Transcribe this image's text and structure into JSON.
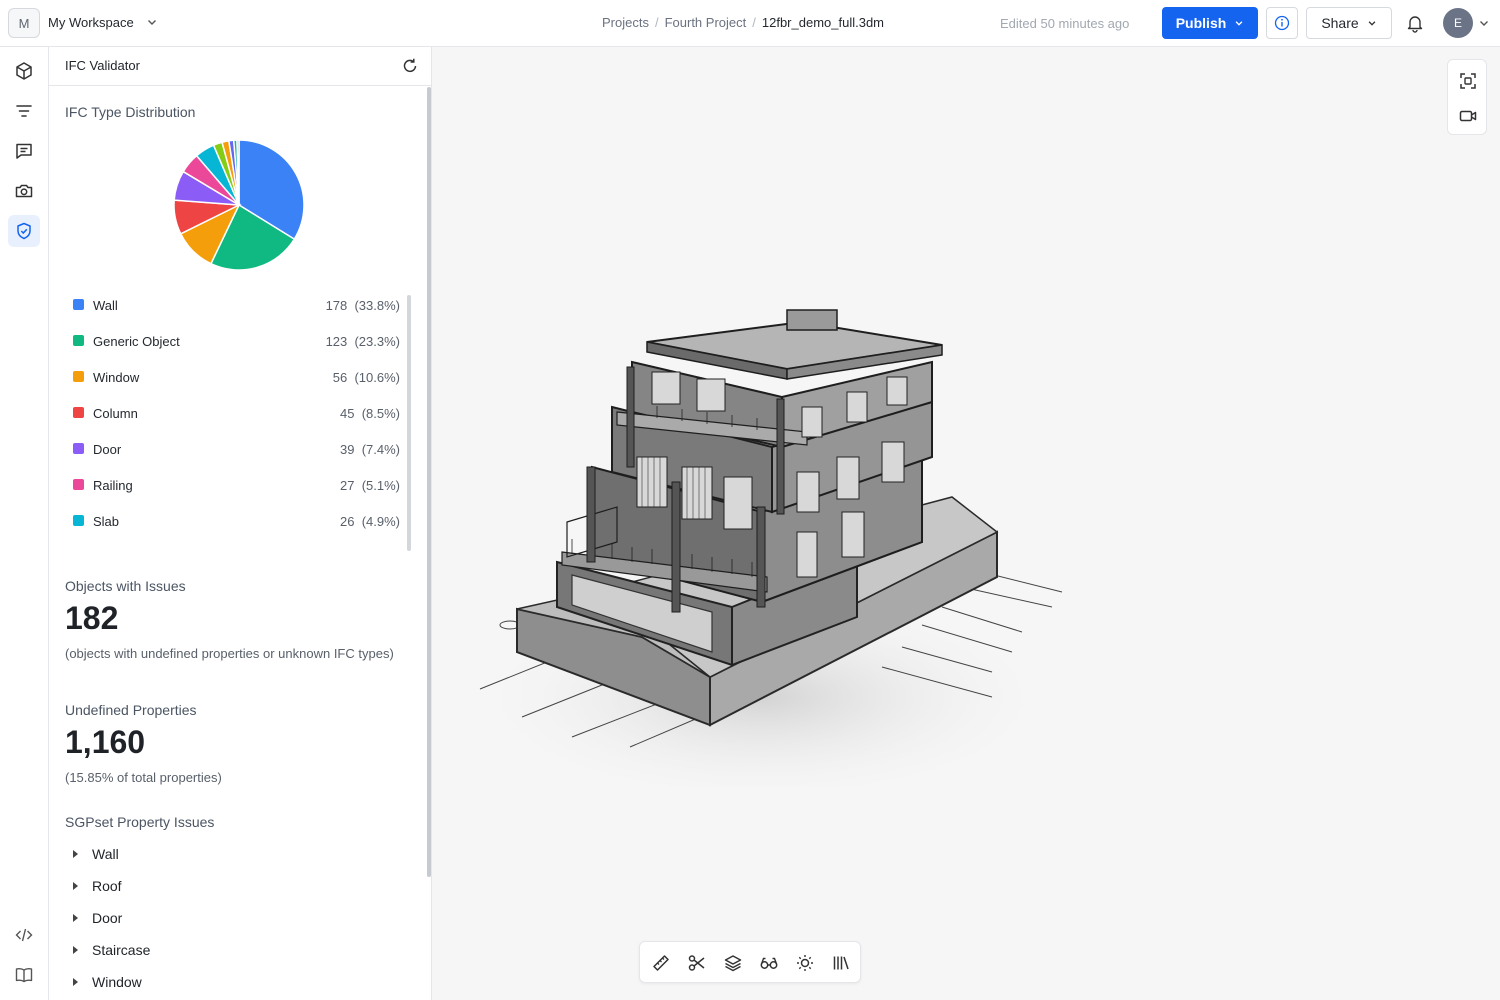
{
  "workspace": {
    "avatar_letter": "M",
    "name": "My Workspace"
  },
  "breadcrumb": {
    "projects": "Projects",
    "project": "Fourth Project",
    "file": "12fbr_demo_full.3dm"
  },
  "status": {
    "edited": "Edited 50 minutes ago"
  },
  "header": {
    "publish_label": "Publish",
    "share_label": "Share",
    "user_initial": "E"
  },
  "rail": {
    "items": [
      "cube-icon",
      "filter-icon",
      "comments-icon",
      "camera-icon",
      "shield-check-icon"
    ],
    "active": "shield-check-icon",
    "bottom": [
      "code-icon",
      "book-icon"
    ]
  },
  "panel": {
    "title": "IFC Validator",
    "distribution_title": "IFC Type Distribution",
    "objects_label": "Objects with Issues",
    "objects_value": "182",
    "objects_note": "(objects with undefined properties or unknown IFC types)",
    "undefined_label": "Undefined Properties",
    "undefined_value": "1,160",
    "undefined_note": "(15.85% of total properties)",
    "sgpset_title": "SGPset Property Issues",
    "sgpset_items": [
      "Wall",
      "Roof",
      "Door",
      "Staircase",
      "Window"
    ]
  },
  "chart_data": {
    "type": "pie",
    "title": "IFC Type Distribution",
    "legend": [
      {
        "name": "Wall",
        "count": 178,
        "percent": "33.8%",
        "color": "#3b82f6"
      },
      {
        "name": "Generic Object",
        "count": 123,
        "percent": "23.3%",
        "color": "#10b981"
      },
      {
        "name": "Window",
        "count": 56,
        "percent": "10.6%",
        "color": "#f59e0b"
      },
      {
        "name": "Column",
        "count": 45,
        "percent": "8.5%",
        "color": "#ef4444"
      },
      {
        "name": "Door",
        "count": 39,
        "percent": "7.4%",
        "color": "#8b5cf6"
      },
      {
        "name": "Railing",
        "count": 27,
        "percent": "5.1%",
        "color": "#ec4899"
      },
      {
        "name": "Slab",
        "count": 26,
        "percent": "4.9%",
        "color": "#06b6d4"
      }
    ],
    "unlisted_slices": [
      {
        "percent": 2.2,
        "color": "#84cc16"
      },
      {
        "percent": 1.7,
        "color": "#f59e0b"
      },
      {
        "percent": 1.2,
        "color": "#6366f1"
      },
      {
        "percent": 0.8,
        "color": "#14b8a6"
      },
      {
        "percent": 0.5,
        "color": "#9ca3af"
      }
    ]
  },
  "viewport_tools": [
    "frame-icon",
    "video-icon"
  ],
  "bottom_toolbar": [
    "ruler-icon",
    "scissors-icon",
    "layers-icon",
    "glasses-icon",
    "sun-icon",
    "library-icon"
  ]
}
